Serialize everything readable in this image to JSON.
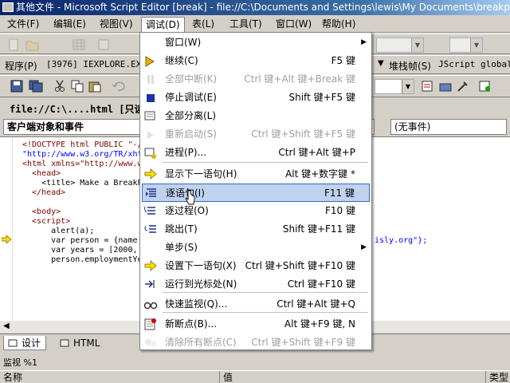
{
  "window": {
    "title": "其他文件 - Microsoft Script Editor [break] - file://C:\\Documents and Settings\\lewis\\My Documents\\breakpoint.htm"
  },
  "menubar": {
    "items": [
      {
        "label": "文件(F)"
      },
      {
        "label": "编辑(E)"
      },
      {
        "label": "视图(V)"
      },
      {
        "label": "调试(D)"
      },
      {
        "label": "表(L)"
      },
      {
        "label": "工具(T)"
      },
      {
        "label": "窗口(W)"
      },
      {
        "label": "帮助(H)"
      }
    ]
  },
  "debug_toolbar": {
    "program_label": "程序(P)",
    "program_value": "[3976] IEXPLORE.EXE:",
    "stack_label": "堆栈帧(S)",
    "stack_value": "JScript global"
  },
  "document": {
    "title": "file://C:\\....html [只读]",
    "object_combo": "客户端对象和事件",
    "event_combo": "(无事件)",
    "code_lines": [
      {
        "t": "<!DOCTYPE html PUBLIC \"-/",
        "cls": "c-tag"
      },
      {
        "t": "\"http://www.w3.org/TR/xht",
        "cls": "c-val"
      },
      {
        "t": "<html xmlns=\"http://www.w",
        "cls": "c-tag"
      },
      {
        "t": "  <head>",
        "cls": "c-tag"
      },
      {
        "t": "    <title> Make a BreakPoi",
        "cls": ""
      },
      {
        "t": "  </head>",
        "cls": "c-tag"
      },
      {
        "t": "",
        "cls": ""
      },
      {
        "t": "  <body>",
        "cls": "c-tag"
      },
      {
        "t": "  <script>",
        "cls": "c-tag"
      },
      {
        "t": "      alert(a);",
        "cls": ""
      },
      {
        "t": "      var person = {name: \"",
        "cls": ""
      },
      {
        "t": "      var years = [2000, 20",
        "cls": ""
      },
      {
        "t": "      person.employmentYear",
        "cls": ""
      }
    ],
    "code_tail": "isly.org\"};"
  },
  "debug_menu": {
    "items": [
      {
        "label": "窗口(W)",
        "shortcut": "",
        "submenu": true,
        "disabled": false,
        "icon": "none"
      },
      {
        "label": "继续(C)",
        "shortcut": "F5 键",
        "disabled": false,
        "icon": "continue-icon"
      },
      {
        "label": "全部中断(K)",
        "shortcut": "Ctrl 键+Alt 键+Break 键",
        "disabled": true,
        "icon": "pause-icon"
      },
      {
        "label": "停止调试(E)",
        "shortcut": "Shift 键+F5 键",
        "disabled": false,
        "icon": "stop-icon"
      },
      {
        "label": "全部分离(L)",
        "shortcut": "",
        "disabled": false,
        "icon": "detach-icon"
      },
      {
        "label": "重新启动(S)",
        "shortcut": "Ctrl 键+Shift 键+F5 键",
        "disabled": true,
        "icon": "restart-icon"
      },
      {
        "label": "进程(P)...",
        "shortcut": "Ctrl 键+Alt 键+P",
        "disabled": false,
        "icon": "process-icon"
      },
      {
        "label": "显示下一语句(H)",
        "shortcut": "Alt 键+数字键 *",
        "disabled": false,
        "icon": "next-statement-icon"
      },
      {
        "label": "逐语句(I)",
        "shortcut": "F11 键",
        "disabled": false,
        "highlighted": true,
        "icon": "step-into-icon"
      },
      {
        "label": "逐过程(O)",
        "shortcut": "F10 键",
        "disabled": false,
        "icon": "step-over-icon"
      },
      {
        "label": "跳出(T)",
        "shortcut": "Shift 键+F11 键",
        "disabled": false,
        "icon": "step-out-icon"
      },
      {
        "label": "单步(S)",
        "shortcut": "",
        "submenu": true,
        "disabled": false,
        "icon": "none"
      },
      {
        "label": "设置下一语句(X)",
        "shortcut": "Ctrl 键+Shift 键+F10 键",
        "disabled": false,
        "icon": "set-next-icon"
      },
      {
        "label": "运行到光标处(N)",
        "shortcut": "Ctrl 键+F10 键",
        "disabled": false,
        "icon": "run-to-cursor-icon"
      },
      {
        "label": "快速监视(Q)...",
        "shortcut": "Ctrl 键+Alt 键+Q",
        "disabled": false,
        "icon": "quickwatch-icon"
      },
      {
        "label": "新断点(B)...",
        "shortcut": "Alt 键+F9 键, N",
        "disabled": false,
        "icon": "new-breakpoint-icon"
      },
      {
        "label": "清除所有断点(C)",
        "shortcut": "Ctrl 键+Shift 键+F9 键",
        "disabled": true,
        "icon": "clear-breakpoints-icon"
      }
    ]
  },
  "bottom": {
    "tabs": [
      {
        "label": "设计"
      },
      {
        "label": "HTML"
      }
    ],
    "watch_title": "监视 %1",
    "watch_columns": [
      "名称",
      "值",
      "类型"
    ]
  }
}
